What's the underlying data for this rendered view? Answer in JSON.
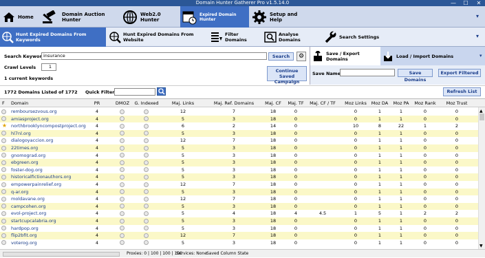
{
  "window": {
    "title": "Domain Hunter Gatherer Pro v1.5.14.0",
    "minimize": "—",
    "maximize": "☐",
    "close": "✕"
  },
  "ribbon": {
    "home": "Home",
    "auction": "Domain Auction Hunter",
    "web20": "Web2.0 Hunter",
    "expired": "Expired Domain Hunter",
    "setup": "Setup and Help"
  },
  "subribbon": {
    "keywords": "Hunt Expired Domains From Keywords",
    "website": "Hunt Expired Domains From Website",
    "filter": "Filter Domains",
    "analyse": "Analyse Domains",
    "search_settings": "Search Settings"
  },
  "search": {
    "keyword_label": "Search Keyword",
    "keyword_value": "insurance",
    "search_button": "Search",
    "crawl_label": "Crawl Levels",
    "crawl_value": "1",
    "current_keywords": "1 current keywords",
    "continue_button": "Continue Saved Campaign"
  },
  "save_panel": {
    "tab_save": "Save / Export Domains",
    "tab_load": "Load / Import Domains",
    "save_name_label": "Save Name",
    "save_name_value": "",
    "save_button": "Save Domains",
    "export_button": "Export Filtered"
  },
  "list_bar": {
    "count": "1772 Domains Listed of 1772",
    "quick_filter_label": "Quick Filter",
    "quick_filter_value": "",
    "refresh_button": "Refresh List"
  },
  "table": {
    "columns": [
      "F",
      "Domain",
      "PR",
      "DMOZ",
      "G. Indexed",
      "Maj. Links",
      "Maj. Ref. Domains",
      "Maj. CF",
      "Maj. TF",
      "Maj. CF / TF",
      "Moz Links",
      "Moz DA",
      "Moz PA",
      "Moz Rank",
      "Moz Trust"
    ],
    "rows": [
      {
        "f": "",
        "domain": "remboursezvous.org",
        "pr": "4",
        "links": "12",
        "ref": "7",
        "cf": "18",
        "tf": "0",
        "cftf": "",
        "mozl": "0",
        "da": "1",
        "pa": "1",
        "rank": "0",
        "trust": "0"
      },
      {
        "f": "",
        "domain": "amiasproject.org",
        "pr": "4",
        "links": "5",
        "ref": "3",
        "cf": "18",
        "tf": "0",
        "cftf": "",
        "mozl": "0",
        "da": "1",
        "pa": "1",
        "rank": "0",
        "trust": "0"
      },
      {
        "f": "★",
        "domain": "northbrooklyncompostproject.org",
        "pr": "4",
        "links": "6",
        "ref": "2",
        "cf": "14",
        "tf": "0",
        "cftf": "",
        "mozl": "10",
        "da": "8",
        "pa": "22",
        "rank": "1",
        "trust": "2"
      },
      {
        "f": "",
        "domain": "hl7nl.org",
        "pr": "4",
        "links": "5",
        "ref": "3",
        "cf": "18",
        "tf": "0",
        "cftf": "",
        "mozl": "0",
        "da": "1",
        "pa": "1",
        "rank": "0",
        "trust": "0"
      },
      {
        "f": "",
        "domain": "dialogoyaccion.org",
        "pr": "4",
        "links": "12",
        "ref": "7",
        "cf": "18",
        "tf": "0",
        "cftf": "",
        "mozl": "0",
        "da": "1",
        "pa": "1",
        "rank": "0",
        "trust": "0"
      },
      {
        "f": "",
        "domain": "22times.org",
        "pr": "4",
        "links": "5",
        "ref": "3",
        "cf": "18",
        "tf": "0",
        "cftf": "",
        "mozl": "0",
        "da": "1",
        "pa": "1",
        "rank": "0",
        "trust": "0"
      },
      {
        "f": "",
        "domain": "gnomograd.org",
        "pr": "4",
        "links": "5",
        "ref": "3",
        "cf": "18",
        "tf": "0",
        "cftf": "",
        "mozl": "0",
        "da": "1",
        "pa": "1",
        "rank": "0",
        "trust": "0"
      },
      {
        "f": "",
        "domain": "ebgreen.org",
        "pr": "4",
        "links": "5",
        "ref": "3",
        "cf": "18",
        "tf": "0",
        "cftf": "",
        "mozl": "0",
        "da": "1",
        "pa": "1",
        "rank": "0",
        "trust": "0"
      },
      {
        "f": "",
        "domain": "foster-dog.org",
        "pr": "4",
        "links": "5",
        "ref": "3",
        "cf": "18",
        "tf": "0",
        "cftf": "",
        "mozl": "0",
        "da": "1",
        "pa": "1",
        "rank": "0",
        "trust": "0"
      },
      {
        "f": "",
        "domain": "historicalfictionauthors.org",
        "pr": "4",
        "links": "5",
        "ref": "3",
        "cf": "18",
        "tf": "0",
        "cftf": "",
        "mozl": "0",
        "da": "1",
        "pa": "1",
        "rank": "0",
        "trust": "0"
      },
      {
        "f": "",
        "domain": "empowerpainrelief.org",
        "pr": "4",
        "links": "12",
        "ref": "7",
        "cf": "18",
        "tf": "0",
        "cftf": "",
        "mozl": "0",
        "da": "1",
        "pa": "1",
        "rank": "0",
        "trust": "0"
      },
      {
        "f": "",
        "domain": "q-ar.org",
        "pr": "4",
        "links": "5",
        "ref": "3",
        "cf": "18",
        "tf": "0",
        "cftf": "",
        "mozl": "0",
        "da": "1",
        "pa": "1",
        "rank": "0",
        "trust": "0"
      },
      {
        "f": "",
        "domain": "moldavane.org",
        "pr": "4",
        "links": "12",
        "ref": "7",
        "cf": "18",
        "tf": "0",
        "cftf": "",
        "mozl": "0",
        "da": "1",
        "pa": "1",
        "rank": "0",
        "trust": "0"
      },
      {
        "f": "",
        "domain": "campcohen.org",
        "pr": "4",
        "links": "5",
        "ref": "3",
        "cf": "18",
        "tf": "0",
        "cftf": "",
        "mozl": "0",
        "da": "1",
        "pa": "1",
        "rank": "0",
        "trust": "0"
      },
      {
        "f": "",
        "domain": "evol-project.org",
        "pr": "4",
        "links": "5",
        "ref": "4",
        "cf": "18",
        "tf": "4",
        "cftf": "4.5",
        "mozl": "1",
        "da": "5",
        "pa": "1",
        "rank": "2",
        "trust": "2"
      },
      {
        "f": "",
        "domain": "startcupcalabria.org",
        "pr": "4",
        "links": "5",
        "ref": "3",
        "cf": "18",
        "tf": "0",
        "cftf": "",
        "mozl": "0",
        "da": "1",
        "pa": "1",
        "rank": "0",
        "trust": "0"
      },
      {
        "f": "",
        "domain": "hardpop.org",
        "pr": "4",
        "links": "5",
        "ref": "3",
        "cf": "18",
        "tf": "0",
        "cftf": "",
        "mozl": "0",
        "da": "1",
        "pa": "1",
        "rank": "0",
        "trust": "0"
      },
      {
        "f": "",
        "domain": "flip2bfit.org",
        "pr": "4",
        "links": "12",
        "ref": "7",
        "cf": "18",
        "tf": "0",
        "cftf": "",
        "mozl": "0",
        "da": "1",
        "pa": "1",
        "rank": "0",
        "trust": "0"
      },
      {
        "f": "",
        "domain": "voterog.org",
        "pr": "4",
        "links": "5",
        "ref": "3",
        "cf": "18",
        "tf": "0",
        "cftf": "",
        "mozl": "0",
        "da": "1",
        "pa": "1",
        "rank": "0",
        "trust": "0"
      }
    ]
  },
  "statusbar": {
    "proxies": "Proxies: 0 | 100 | 100 | 100",
    "services": "Services: None",
    "state": "Saved Column State"
  },
  "colors": {
    "ribbon_selected": "#3f6fc4",
    "title_bar": "#2b5797",
    "row_alt": "#fbf8c8",
    "link": "#1a3d8a"
  }
}
